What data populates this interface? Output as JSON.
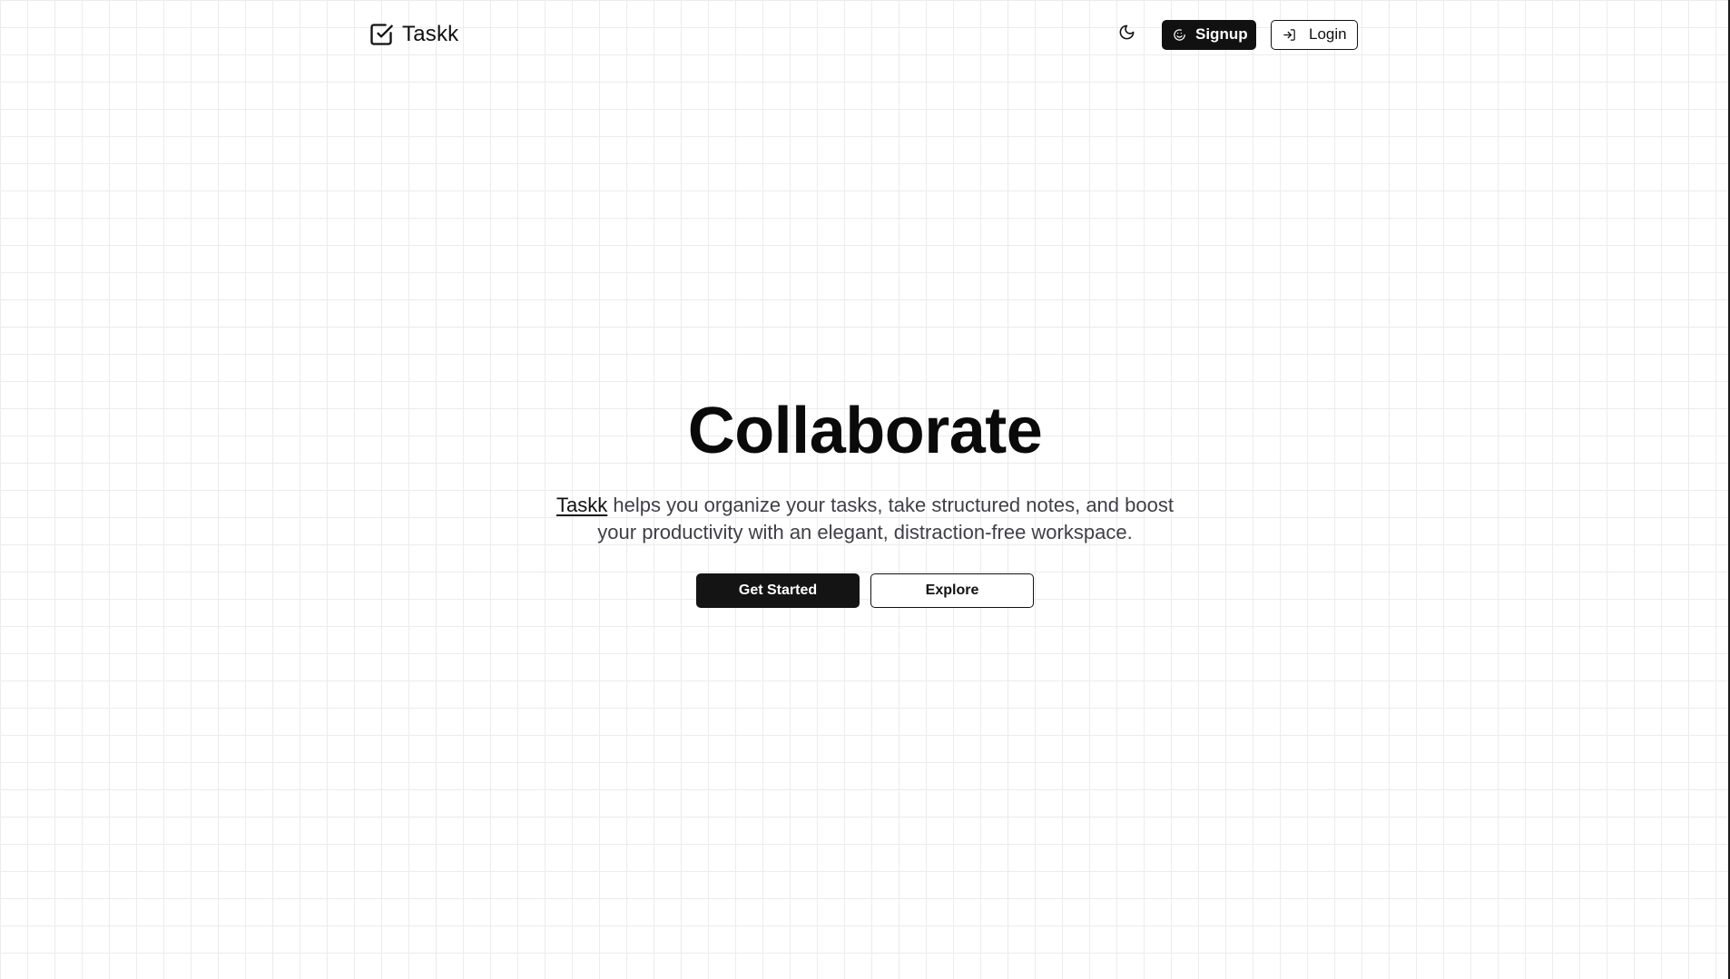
{
  "header": {
    "brand_name": "Taskk",
    "brand_icon": "checkbox-icon",
    "theme_toggle_icon": "moon-icon",
    "signup_label": "Signup",
    "signup_icon": "smile-icon",
    "login_label": "Login",
    "login_icon": "log-in-icon"
  },
  "hero": {
    "title": "Collaborate",
    "subtitle_brand": "Taskk",
    "subtitle_text": " helps you organize your tasks, take structured notes, and boost your productivity with an elegant, distraction-free workspace.",
    "primary_cta": "Get Started",
    "secondary_cta": "Explore"
  },
  "colors": {
    "primary": "#111111",
    "text_muted": "#3f3f46",
    "grid_line": "#ececec",
    "background": "#ffffff"
  }
}
